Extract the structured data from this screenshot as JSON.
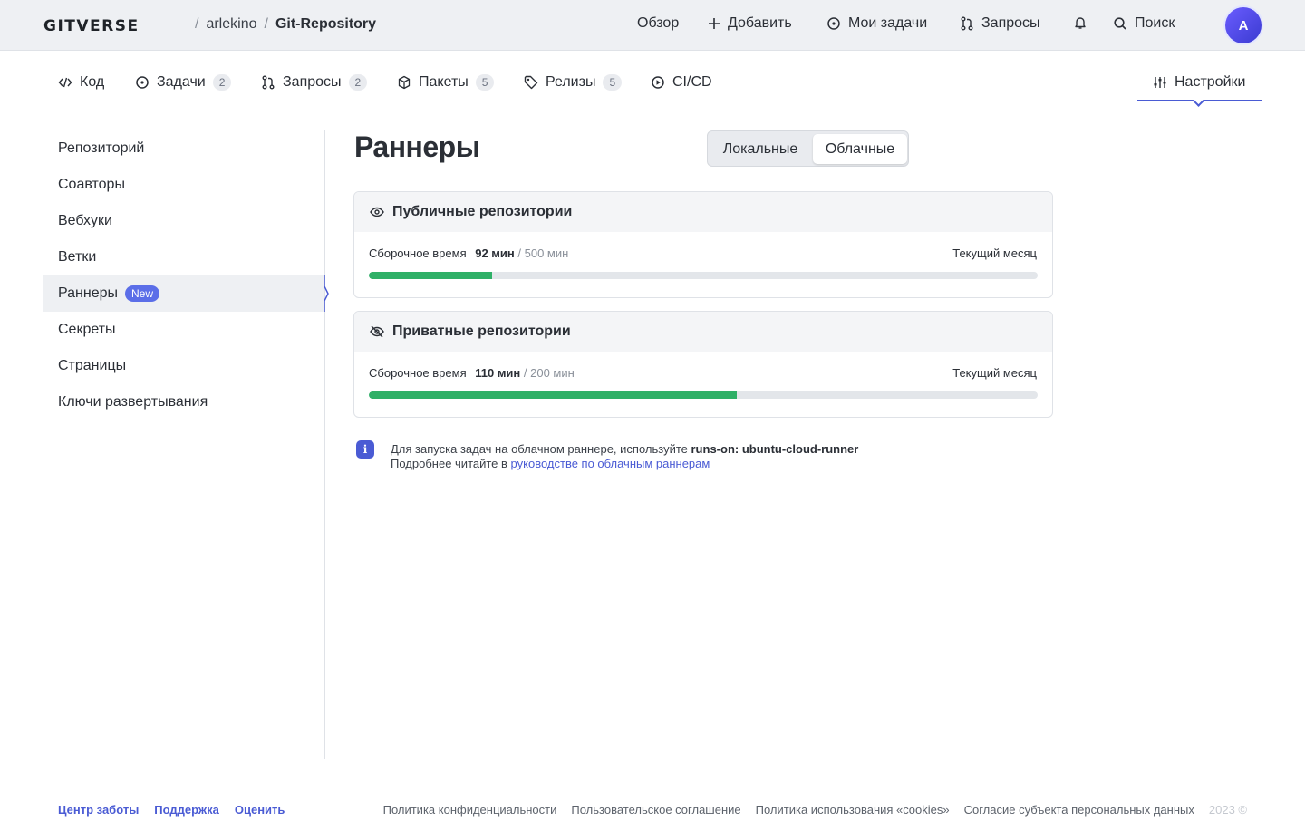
{
  "header": {
    "logo": "GITVERSE",
    "breadcrumb": {
      "owner": "arlekino",
      "separator": "/",
      "repo": "Git-Repository"
    },
    "nav": {
      "overview": "Обзор",
      "add": "Добавить",
      "my_tasks": "Мои задачи",
      "requests": "Запросы",
      "search": "Поиск"
    },
    "avatar_initial": "A"
  },
  "tabs": {
    "code": {
      "label": "Код"
    },
    "issues": {
      "label": "Задачи",
      "count": "2"
    },
    "pulls": {
      "label": "Запросы",
      "count": "2"
    },
    "packages": {
      "label": "Пакеты",
      "count": "5"
    },
    "releases": {
      "label": "Релизы",
      "count": "5"
    },
    "cicd": {
      "label": "CI/CD"
    },
    "settings": {
      "label": "Настройки"
    }
  },
  "sidebar": {
    "items": [
      "Репозиторий",
      "Соавторы",
      "Вебхуки",
      "Ветки",
      "Раннеры",
      "Секреты",
      "Страницы",
      "Ключи развертывания"
    ],
    "active_index": 4,
    "new_badge": "New"
  },
  "main": {
    "title": "Раннеры",
    "segment": {
      "local": "Локальные",
      "cloud": "Облачные",
      "selected": "cloud"
    },
    "public": {
      "title": "Публичные репозитории",
      "usage_label": "Сборочное время",
      "used": "92 мин",
      "limit": "/ 500 мин",
      "period": "Текущий месяц",
      "progress": 0.184
    },
    "private": {
      "title": "Приватные репозитории",
      "usage_label": "Сборочное время",
      "used": "110 мин",
      "limit": "/ 200 мин",
      "period": "Текущий месяц",
      "progress": 0.55
    },
    "info": {
      "line1_prefix": "Для запуска задач на облачном раннере, используйте",
      "line1_code": "runs-on: ubuntu-cloud-runner",
      "line2_prefix": "Подробнее читайте в",
      "line2_link": "руководстве по облачным раннерам"
    }
  },
  "footer": {
    "links_left": [
      "Центр заботы",
      "Поддержка",
      "Оценить"
    ],
    "links_right": [
      "Политика конфиденциальности",
      "Пользовательское соглашение",
      "Политика использования «cookies»",
      "Согласие субъекта персональных данных"
    ],
    "copyright": "2023 ©"
  },
  "colors": {
    "accent": "#4a5bd4",
    "progress": "#2fb067",
    "badge_new": "#5b6ee8"
  }
}
